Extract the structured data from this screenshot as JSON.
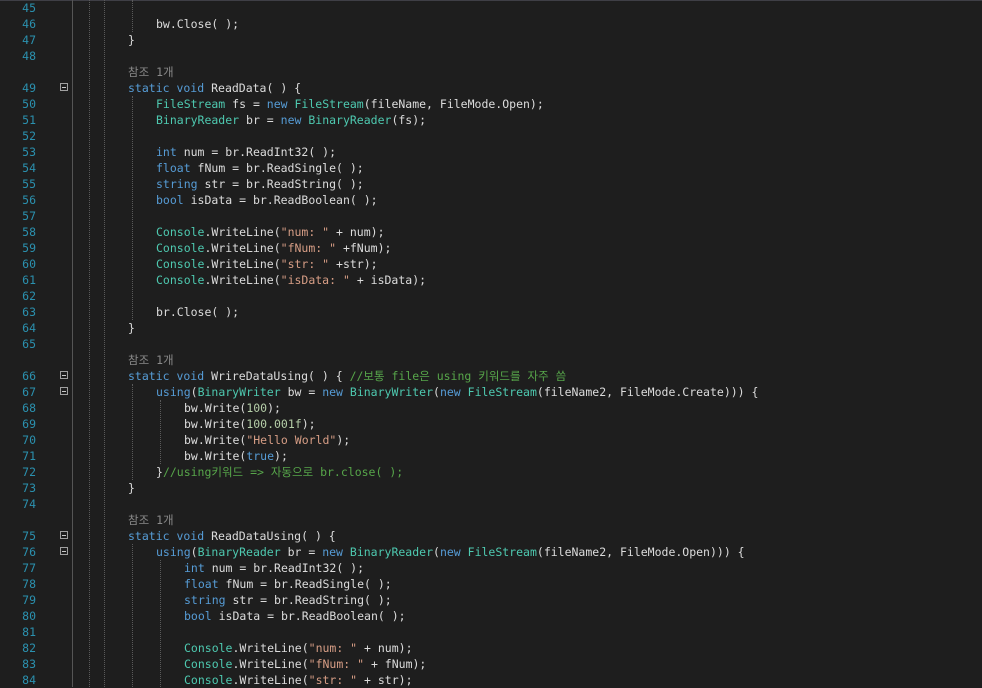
{
  "editor": {
    "language": "C#",
    "colors": {
      "background": "#1e1e1e",
      "line_number": "#2b91af",
      "keyword": "#569cd6",
      "type": "#4ec9b0",
      "string": "#d69d85",
      "comment": "#57a64a",
      "number": "#b5cea8",
      "text": "#dcdcdc",
      "codelens": "#8a8a8a"
    },
    "lines": [
      {
        "n": "45",
        "code": []
      },
      {
        "n": "46",
        "code": [
          [
            "bw.Close( );",
            "t"
          ]
        ]
      },
      {
        "n": "47",
        "code": [
          [
            "}",
            "t"
          ]
        ]
      },
      {
        "n": "48",
        "code": [],
        "ref": "참조 1개"
      },
      {
        "n": "49",
        "fold": true,
        "code": [
          [
            "static void ",
            "k"
          ],
          [
            "ReadData( ) {",
            "t"
          ]
        ]
      },
      {
        "n": "50",
        "code": [
          [
            "FileStream",
            "y"
          ],
          [
            " fs = ",
            "t"
          ],
          [
            "new ",
            "k"
          ],
          [
            "FileStream",
            "y"
          ],
          [
            "(fileName, FileMode.Open);",
            "t"
          ]
        ]
      },
      {
        "n": "51",
        "code": [
          [
            "BinaryReader",
            "y"
          ],
          [
            " br = ",
            "t"
          ],
          [
            "new ",
            "k"
          ],
          [
            "BinaryReader",
            "y"
          ],
          [
            "(fs);",
            "t"
          ]
        ]
      },
      {
        "n": "52",
        "code": []
      },
      {
        "n": "53",
        "code": [
          [
            "int",
            "k"
          ],
          [
            " num = br.ReadInt32( );",
            "t"
          ]
        ]
      },
      {
        "n": "54",
        "code": [
          [
            "float",
            "k"
          ],
          [
            " fNum = br.ReadSingle( );",
            "t"
          ]
        ]
      },
      {
        "n": "55",
        "code": [
          [
            "string",
            "k"
          ],
          [
            " str = br.ReadString( );",
            "t"
          ]
        ]
      },
      {
        "n": "56",
        "code": [
          [
            "bool",
            "k"
          ],
          [
            " isData = br.ReadBoolean( );",
            "t"
          ]
        ]
      },
      {
        "n": "57",
        "code": []
      },
      {
        "n": "58",
        "code": [
          [
            "Console",
            "y"
          ],
          [
            ".WriteLine(",
            "t"
          ],
          [
            "\"num: \"",
            "s"
          ],
          [
            " + num);",
            "t"
          ]
        ]
      },
      {
        "n": "59",
        "code": [
          [
            "Console",
            "y"
          ],
          [
            ".WriteLine(",
            "t"
          ],
          [
            "\"fNum: \"",
            "s"
          ],
          [
            " +fNum);",
            "t"
          ]
        ]
      },
      {
        "n": "60",
        "code": [
          [
            "Console",
            "y"
          ],
          [
            ".WriteLine(",
            "t"
          ],
          [
            "\"str: \"",
            "s"
          ],
          [
            " +str);",
            "t"
          ]
        ]
      },
      {
        "n": "61",
        "code": [
          [
            "Console",
            "y"
          ],
          [
            ".WriteLine(",
            "t"
          ],
          [
            "\"isData: \"",
            "s"
          ],
          [
            " + isData);",
            "t"
          ]
        ]
      },
      {
        "n": "62",
        "code": []
      },
      {
        "n": "63",
        "code": [
          [
            "br.Close( );",
            "t"
          ]
        ]
      },
      {
        "n": "64",
        "code": [
          [
            "}",
            "t"
          ]
        ]
      },
      {
        "n": "65",
        "code": [],
        "ref": "참조 1개"
      },
      {
        "n": "66",
        "fold": true,
        "code": [
          [
            "static void ",
            "k"
          ],
          [
            "WrireDataUsing( ) { ",
            "t"
          ],
          [
            "//보통 file은 using 키워드를 자주 씀",
            "c"
          ]
        ]
      },
      {
        "n": "67",
        "fold": true,
        "code": [
          [
            "using",
            "k"
          ],
          [
            "(",
            "t"
          ],
          [
            "BinaryWriter",
            "y"
          ],
          [
            " bw = ",
            "t"
          ],
          [
            "new ",
            "k"
          ],
          [
            "BinaryWriter",
            "y"
          ],
          [
            "(",
            "t"
          ],
          [
            "new ",
            "k"
          ],
          [
            "FileStream",
            "y"
          ],
          [
            "(fileName2, FileMode.Create))) {",
            "t"
          ]
        ]
      },
      {
        "n": "68",
        "code": [
          [
            "bw.Write(",
            "t"
          ],
          [
            "100",
            "n"
          ],
          [
            ");",
            "t"
          ]
        ]
      },
      {
        "n": "69",
        "code": [
          [
            "bw.Write(",
            "t"
          ],
          [
            "100.001f",
            "n"
          ],
          [
            ");",
            "t"
          ]
        ]
      },
      {
        "n": "70",
        "code": [
          [
            "bw.Write(",
            "t"
          ],
          [
            "\"Hello World\"",
            "s"
          ],
          [
            ");",
            "t"
          ]
        ]
      },
      {
        "n": "71",
        "code": [
          [
            "bw.Write(",
            "t"
          ],
          [
            "true",
            "k"
          ],
          [
            ");",
            "t"
          ]
        ]
      },
      {
        "n": "72",
        "code": [
          [
            "}",
            "t"
          ],
          [
            "//using키워드 => 자동으로 br.close( );",
            "c"
          ]
        ]
      },
      {
        "n": "73",
        "code": [
          [
            "}",
            "t"
          ]
        ]
      },
      {
        "n": "74",
        "code": [],
        "ref": "참조 1개"
      },
      {
        "n": "75",
        "fold": true,
        "code": [
          [
            "static void ",
            "k"
          ],
          [
            "ReadDataUsing( ) {",
            "t"
          ]
        ]
      },
      {
        "n": "76",
        "fold": true,
        "code": [
          [
            "using",
            "k"
          ],
          [
            "(",
            "t"
          ],
          [
            "BinaryReader",
            "y"
          ],
          [
            " br = ",
            "t"
          ],
          [
            "new ",
            "k"
          ],
          [
            "BinaryReader",
            "y"
          ],
          [
            "(",
            "t"
          ],
          [
            "new ",
            "k"
          ],
          [
            "FileStream",
            "y"
          ],
          [
            "(fileName2, FileMode.Open))) {",
            "t"
          ]
        ]
      },
      {
        "n": "77",
        "code": [
          [
            "int",
            "k"
          ],
          [
            " num = br.ReadInt32( );",
            "t"
          ]
        ]
      },
      {
        "n": "78",
        "code": [
          [
            "float",
            "k"
          ],
          [
            " fNum = br.ReadSingle( );",
            "t"
          ]
        ]
      },
      {
        "n": "79",
        "code": [
          [
            "string",
            "k"
          ],
          [
            " str = br.ReadString( );",
            "t"
          ]
        ]
      },
      {
        "n": "80",
        "code": [
          [
            "bool",
            "k"
          ],
          [
            " isData = br.ReadBoolean( );",
            "t"
          ]
        ]
      },
      {
        "n": "81",
        "code": []
      },
      {
        "n": "82",
        "code": [
          [
            "Console",
            "y"
          ],
          [
            ".WriteLine(",
            "t"
          ],
          [
            "\"num: \"",
            "s"
          ],
          [
            " + num);",
            "t"
          ]
        ]
      },
      {
        "n": "83",
        "code": [
          [
            "Console",
            "y"
          ],
          [
            ".WriteLine(",
            "t"
          ],
          [
            "\"fNum: \"",
            "s"
          ],
          [
            " + fNum);",
            "t"
          ]
        ]
      },
      {
        "n": "84",
        "code": [
          [
            "Console",
            "y"
          ],
          [
            ".WriteLine(",
            "t"
          ],
          [
            "\"str: \"",
            "s"
          ],
          [
            " + str);",
            "t"
          ]
        ]
      }
    ]
  }
}
